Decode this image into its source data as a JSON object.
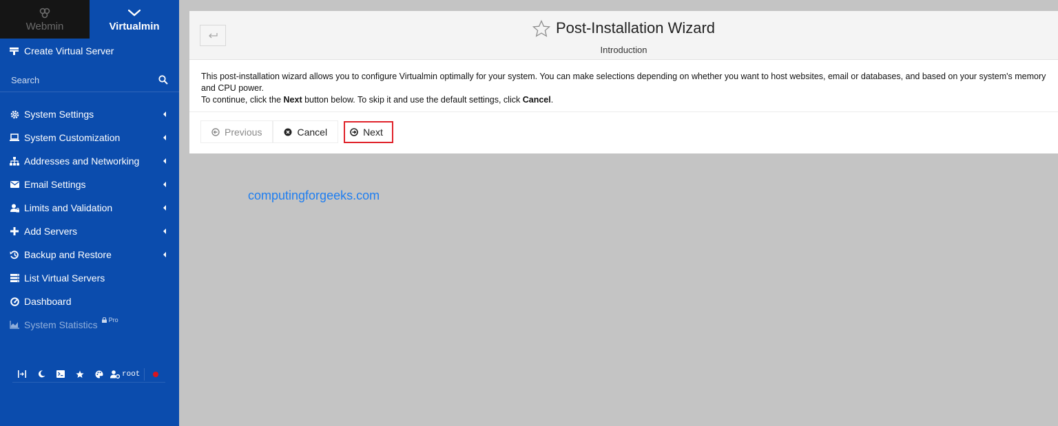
{
  "switcher": {
    "webmin_label": "Webmin",
    "virtualmin_label": "Virtualmin"
  },
  "sidebar": {
    "create_label": "Create Virtual Server",
    "search_placeholder": "Search",
    "items": [
      {
        "label": "System Settings",
        "icon": "gear-icon"
      },
      {
        "label": "System Customization",
        "icon": "laptop-icon"
      },
      {
        "label": "Addresses and Networking",
        "icon": "sitemap-icon"
      },
      {
        "label": "Email Settings",
        "icon": "envelope-icon"
      },
      {
        "label": "Limits and Validation",
        "icon": "user-lock-icon"
      },
      {
        "label": "Add Servers",
        "icon": "plus-icon"
      },
      {
        "label": "Backup and Restore",
        "icon": "history-icon"
      },
      {
        "label": "List Virtual Servers",
        "icon": "list-icon"
      },
      {
        "label": "Dashboard",
        "icon": "dashboard-icon"
      },
      {
        "label": "System Statistics",
        "icon": "area-chart-icon",
        "badge": "Pro"
      }
    ],
    "bottom": {
      "username": "root"
    }
  },
  "panel": {
    "title": "Post-Installation Wizard",
    "subtitle": "Introduction",
    "intro_line1": "This post-installation wizard allows you to configure Virtualmin optimally for your system. You can make selections depending on whether you want to host websites, email or databases, and based on your system's memory and CPU power.",
    "intro_line2_prefix": "To continue, click the ",
    "intro_line2_next": "Next",
    "intro_line2_middle": " button below. To skip it and use the default settings, click ",
    "intro_line2_cancel": "Cancel",
    "intro_line2_suffix": ".",
    "buttons": {
      "previous": "Previous",
      "cancel": "Cancel",
      "next": "Next"
    }
  },
  "watermark": "computingforgeeks.com",
  "colors": {
    "sidebar_bg": "#0b4cad",
    "highlight_border": "#e0222a",
    "watermark": "#1f7ef0"
  }
}
